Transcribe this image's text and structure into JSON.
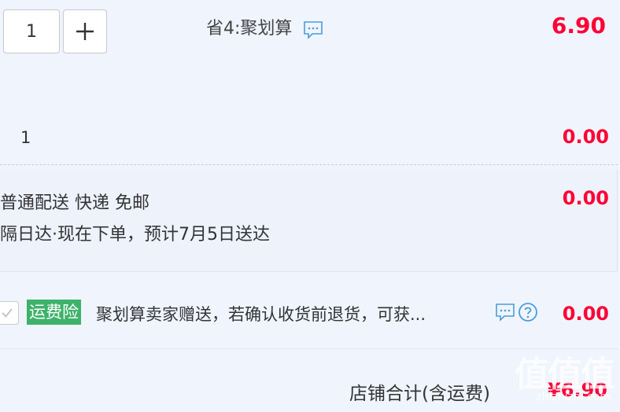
{
  "item": {
    "quantity": "1",
    "promo_label": "省4:聚划算",
    "price": "6.90"
  },
  "gift": {
    "quantity": "1",
    "price": "0.00"
  },
  "delivery": {
    "line1": "普通配送 快递 免邮",
    "line2": "隔日达·现在下单，预计7月5日送达",
    "price": "0.00"
  },
  "insurance": {
    "badge": "运费险",
    "text": "聚划算卖家赠送，若确认收货前退货，可获...",
    "price": "0.00"
  },
  "total": {
    "label": "店铺合计(含运费)",
    "price": "¥6.90"
  },
  "watermark": {
    "main": "值值值",
    "sub": "zhizhizhi.com"
  },
  "colors": {
    "price": "#ff0036",
    "insurance_badge": "#3eb26a",
    "icon_blue": "#4a9ed8"
  }
}
